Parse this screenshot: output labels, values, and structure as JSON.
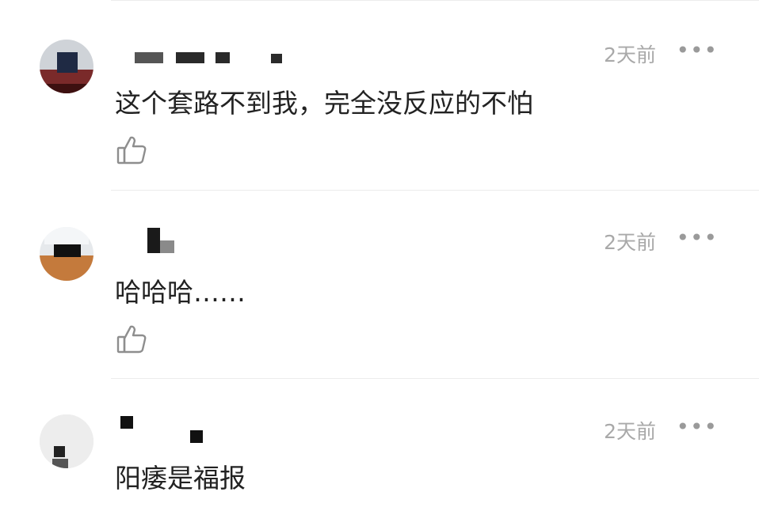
{
  "comments": [
    {
      "text": "这个套路不到我，完全没反应的不怕",
      "timestamp": "2天前",
      "more_label": "•••",
      "like_icon": "thumb-up-icon"
    },
    {
      "text": "哈哈哈……",
      "timestamp": "2天前",
      "more_label": "•••",
      "like_icon": "thumb-up-icon"
    },
    {
      "text": "阳痿是福报",
      "timestamp": "2天前",
      "more_label": "•••"
    }
  ],
  "colors": {
    "text": "#222222",
    "timestamp": "#a9a9a9",
    "divider": "#ececec",
    "icon": "#8e8e8e"
  }
}
